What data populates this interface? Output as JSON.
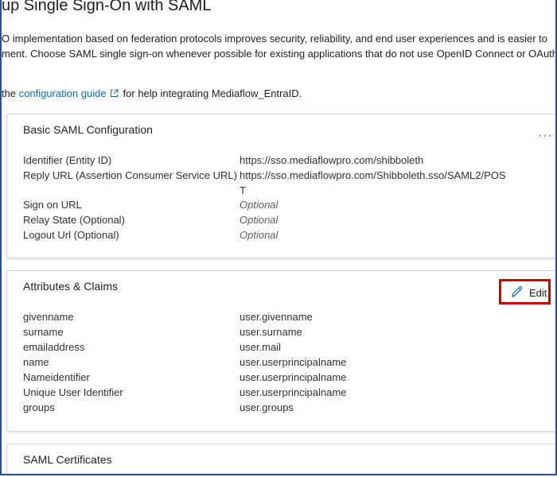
{
  "page": {
    "title": "up Single Sign-On with SAML",
    "intro_line1": "O implementation based on federation protocols improves security, reliability, and end user experiences and is easier to",
    "intro_line2": "ment. Choose SAML single sign-on whenever possible for existing applications that do not use OpenID Connect or OAuth.",
    "guide_prefix": "the ",
    "guide_link": "configuration guide",
    "guide_suffix": "for help integrating Mediaflow_EntraID."
  },
  "basic_saml": {
    "title": "Basic SAML Configuration",
    "more_label": "···",
    "rows": [
      {
        "label": "Identifier (Entity ID)",
        "value": "https://sso.mediaflowpro.com/shibboleth"
      },
      {
        "label": "Reply URL (Assertion Consumer Service URL)",
        "value": "https://sso.mediaflowpro.com/Shibboleth.sso/SAML2/POST"
      },
      {
        "label": "Sign on URL",
        "value": "Optional"
      },
      {
        "label": "Relay State (Optional)",
        "value": "Optional"
      },
      {
        "label": "Logout Url (Optional)",
        "value": "Optional"
      }
    ]
  },
  "attributes": {
    "title": "Attributes & Claims",
    "edit_label": "Edit",
    "rows": [
      {
        "label": "givenname",
        "value": "user.givenname"
      },
      {
        "label": "surname",
        "value": "user.surname"
      },
      {
        "label": "emailaddress",
        "value": "user.mail"
      },
      {
        "label": "name",
        "value": "user.userprincipalname"
      },
      {
        "label": "Nameidentifier",
        "value": "user.userprincipalname"
      },
      {
        "label": "Unique User Identifier",
        "value": "user.userprincipalname"
      },
      {
        "label": "groups",
        "value": "user.groups"
      }
    ]
  },
  "certificates": {
    "title": "SAML Certificates"
  },
  "colors": {
    "link": "#0f6cbd",
    "highlight_border": "#cc0000",
    "frame_border": "#2b4e8c"
  }
}
